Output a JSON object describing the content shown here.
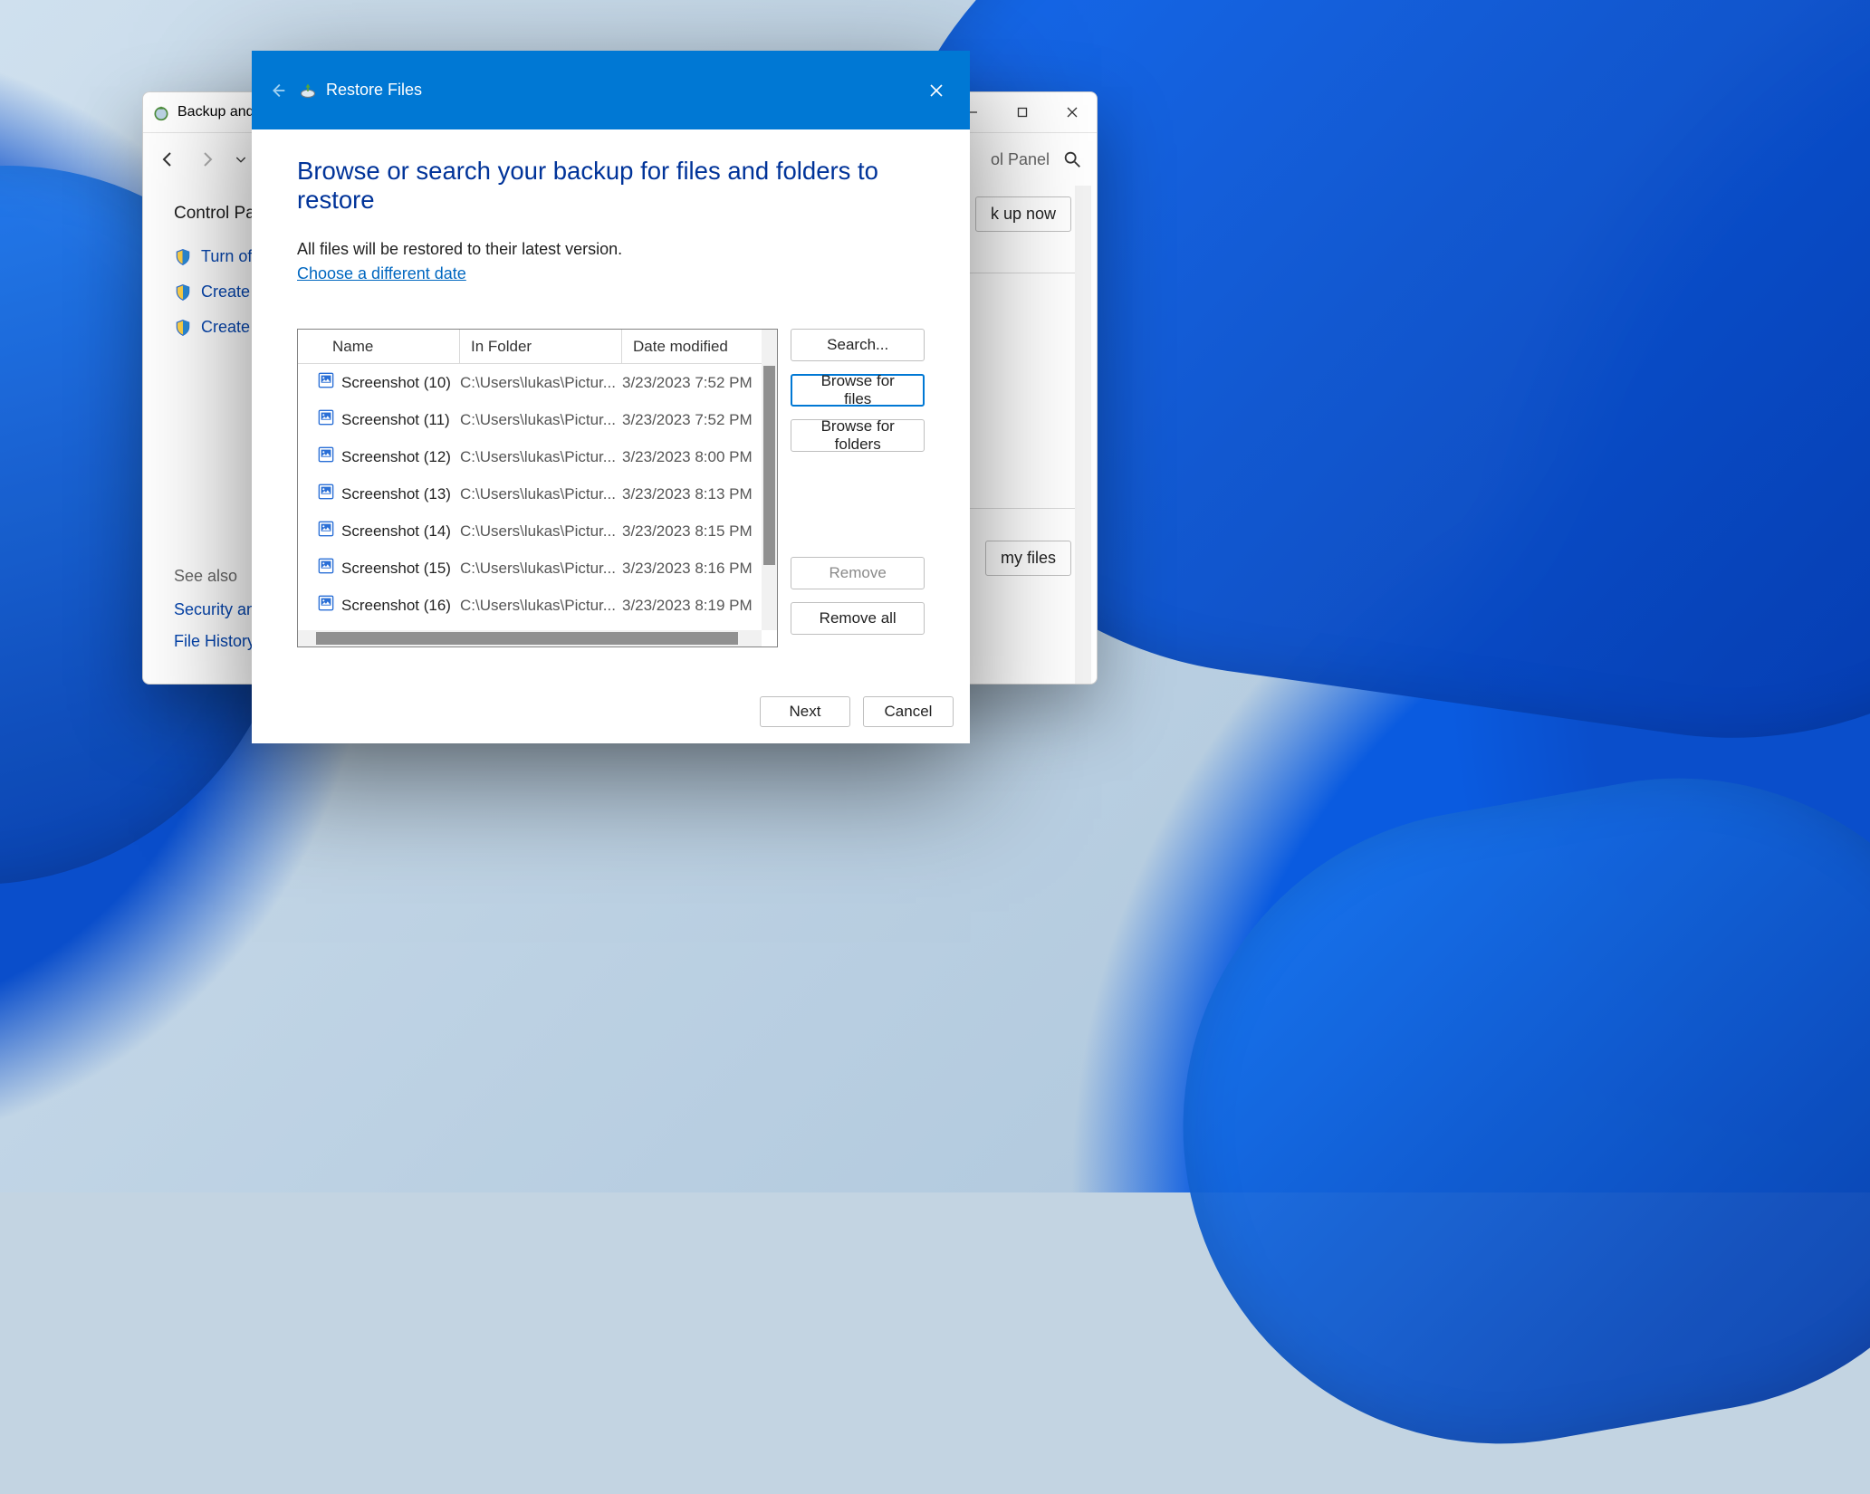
{
  "wallpaper": {
    "name": "windows-11-bloom"
  },
  "control_panel_window": {
    "title": "Backup and R",
    "win_controls": {
      "min": "—",
      "max": "▢",
      "close": "✕"
    },
    "search_hint": "ol Panel",
    "home_label": "Control Pane",
    "tasks": [
      "Turn off sche",
      "Create a syst",
      "Create a syst"
    ],
    "see_also_label": "See also",
    "see_also_links": [
      "Security and",
      "File History"
    ],
    "backup_now_label": "k up now",
    "restore_mine_label": "my files"
  },
  "restore_dialog": {
    "title": "Restore Files",
    "close_tooltip": "Close",
    "heading": "Browse or search your backup for files and folders to restore",
    "description": "All files will be restored to their latest version.",
    "choose_date_link": "Choose a different date",
    "columns": {
      "name": "Name",
      "folder": "In Folder",
      "modified": "Date modified"
    },
    "rows": [
      {
        "name": "Screenshot (10)",
        "folder": "C:\\Users\\lukas\\Pictur...",
        "modified": "3/23/2023 7:52 PM"
      },
      {
        "name": "Screenshot (11)",
        "folder": "C:\\Users\\lukas\\Pictur...",
        "modified": "3/23/2023 7:52 PM"
      },
      {
        "name": "Screenshot (12)",
        "folder": "C:\\Users\\lukas\\Pictur...",
        "modified": "3/23/2023 8:00 PM"
      },
      {
        "name": "Screenshot (13)",
        "folder": "C:\\Users\\lukas\\Pictur...",
        "modified": "3/23/2023 8:13 PM"
      },
      {
        "name": "Screenshot (14)",
        "folder": "C:\\Users\\lukas\\Pictur...",
        "modified": "3/23/2023 8:15 PM"
      },
      {
        "name": "Screenshot (15)",
        "folder": "C:\\Users\\lukas\\Pictur...",
        "modified": "3/23/2023 8:16 PM"
      },
      {
        "name": "Screenshot (16)",
        "folder": "C:\\Users\\lukas\\Pictur...",
        "modified": "3/23/2023 8:19 PM"
      }
    ],
    "buttons": {
      "search": "Search...",
      "browse_files": "Browse for files",
      "browse_folders": "Browse for folders",
      "remove": "Remove",
      "remove_all": "Remove all",
      "next": "Next",
      "cancel": "Cancel"
    }
  }
}
